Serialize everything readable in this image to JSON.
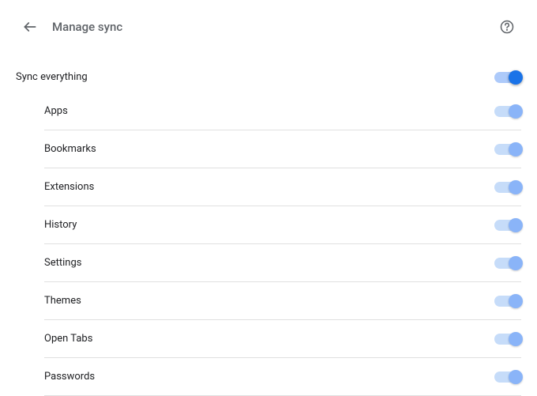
{
  "header": {
    "title": "Manage sync"
  },
  "master": {
    "label": "Sync everything",
    "state": "on-primary"
  },
  "items": [
    {
      "label": "Apps",
      "state": "on-locked"
    },
    {
      "label": "Bookmarks",
      "state": "on-locked"
    },
    {
      "label": "Extensions",
      "state": "on-locked"
    },
    {
      "label": "History",
      "state": "on-locked"
    },
    {
      "label": "Settings",
      "state": "on-locked"
    },
    {
      "label": "Themes",
      "state": "on-locked"
    },
    {
      "label": "Open Tabs",
      "state": "on-locked"
    },
    {
      "label": "Passwords",
      "state": "on-locked"
    }
  ]
}
